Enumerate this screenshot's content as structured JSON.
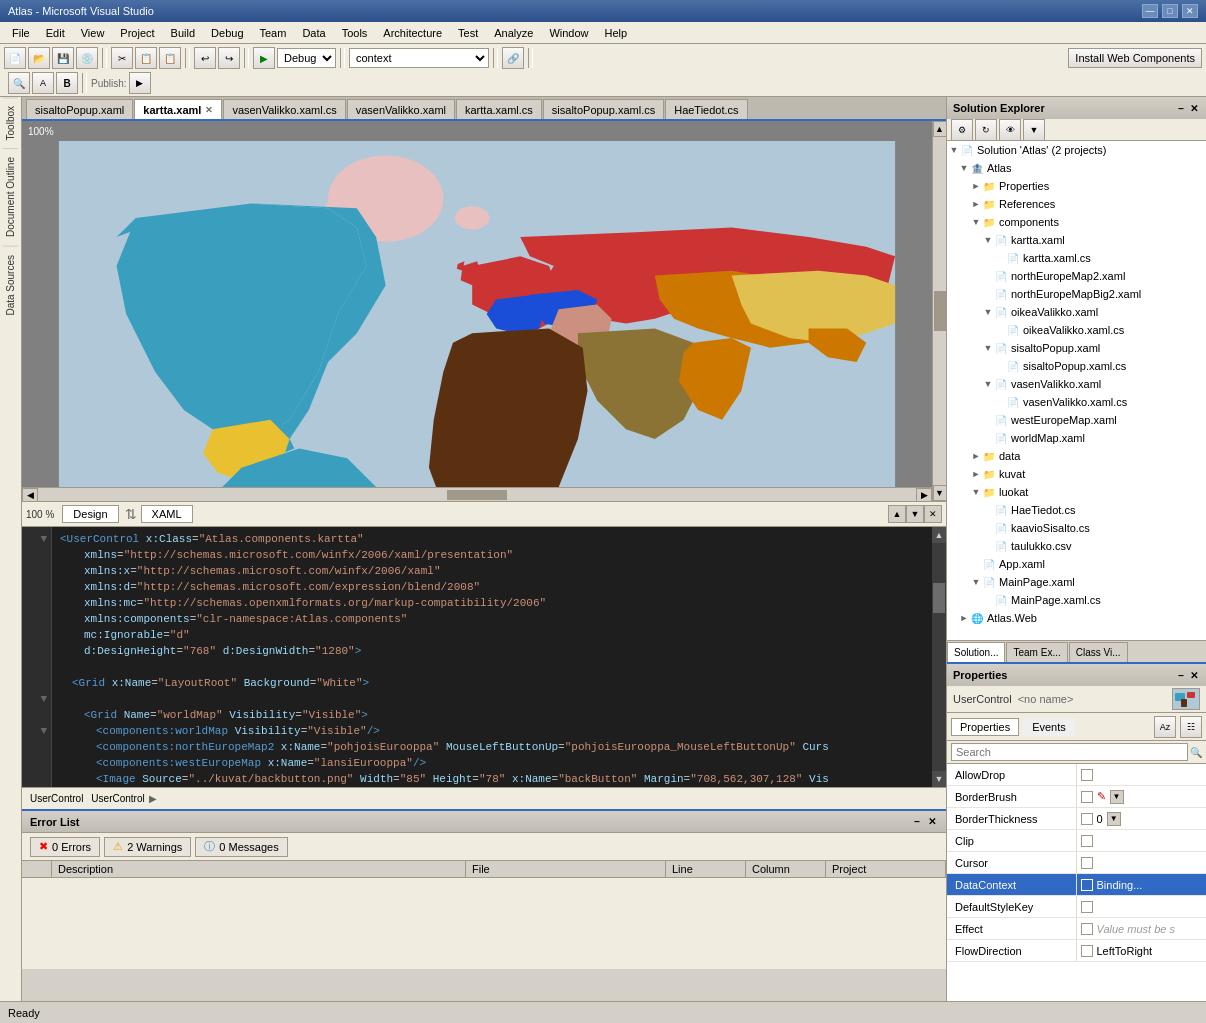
{
  "titleBar": {
    "title": "Atlas - Microsoft Visual Studio",
    "controls": [
      "minimize",
      "maximize",
      "close"
    ]
  },
  "menuBar": {
    "items": [
      "File",
      "Edit",
      "View",
      "Project",
      "Build",
      "Debug",
      "Team",
      "Data",
      "Tools",
      "Architecture",
      "Test",
      "Analyze",
      "Window",
      "Help"
    ]
  },
  "toolbar": {
    "debugMode": "Debug",
    "context": "context",
    "installWebComponents": "Install Web Components"
  },
  "documentTabs": {
    "tabs": [
      {
        "label": "sisaltoPopup.xaml",
        "active": false,
        "closeable": false
      },
      {
        "label": "kartta.xaml",
        "active": true,
        "closeable": true
      },
      {
        "label": "vasenValikko.xaml.cs",
        "active": false,
        "closeable": false
      },
      {
        "label": "vasenValikko.xaml",
        "active": false,
        "closeable": false
      },
      {
        "label": "kartta.xaml.cs",
        "active": false,
        "closeable": false
      },
      {
        "label": "sisaltoPopup.xaml.cs",
        "active": false,
        "closeable": false
      },
      {
        "label": "HaeTiedot.cs",
        "active": false,
        "closeable": false
      }
    ]
  },
  "viewTabs": {
    "design": "Design",
    "xaml": "XAML",
    "zoom": "100%"
  },
  "xamlCode": {
    "lines": [
      {
        "indent": 0,
        "content": "<UserControl x:Class=\"Atlas.components.kartta\""
      },
      {
        "indent": 1,
        "content": "xmlns=\"http://schemas.microsoft.com/winfx/2006/xaml/presentation\""
      },
      {
        "indent": 1,
        "content": "xmlns:x=\"http://schemas.microsoft.com/winfx/2006/xaml\""
      },
      {
        "indent": 1,
        "content": "xmlns:d=\"http://schemas.microsoft.com/expression/blend/2008\""
      },
      {
        "indent": 1,
        "content": "xmlns:mc=\"http://schemas.openxmlformats.org/markup-compatibility/2006\""
      },
      {
        "indent": 1,
        "content": "xmlns:components=\"clr-namespace:Atlas.components\""
      },
      {
        "indent": 1,
        "content": "mc:Ignorable=\"d\""
      },
      {
        "indent": 1,
        "content": "d:DesignHeight=\"768\" d:DesignWidth=\"1280\">"
      },
      {
        "indent": 0,
        "content": ""
      },
      {
        "indent": 1,
        "content": "<Grid x:Name=\"LayoutRoot\" Background=\"White\">"
      },
      {
        "indent": 0,
        "content": ""
      },
      {
        "indent": 2,
        "content": "<Grid Name=\"worldMap\" Visibility=\"Visible\">"
      },
      {
        "indent": 3,
        "content": "<components:worldMap Visibility=\"Visible\"/>"
      },
      {
        "indent": 3,
        "content": "<components:northEuropeMap2 x:Name=\"pohjoisEurooppa\" MouseLeftButtonUp=\"pohjoisEurooppa_MouseLeftButtonUp\" Curs"
      },
      {
        "indent": 3,
        "content": "<components:westEuropeMap x:Name=\"lansiEurooppa\"/>"
      },
      {
        "indent": 3,
        "content": "<Image Source=\"../kuvat/backbutton.png\" Width=\"85\" Height=\"78\" x:Name=\"backButton\" Margin=\"708,562,307,128\" Vis"
      }
    ]
  },
  "xamlStatus": {
    "element": "UserControl",
    "name": "UserControl"
  },
  "solutionExplorer": {
    "title": "Solution Explorer",
    "solutionLabel": "Solution 'Atlas' (2 projects)",
    "tree": [
      {
        "level": 0,
        "type": "solution",
        "label": "Solution 'Atlas' (2 projects)",
        "expanded": true
      },
      {
        "level": 1,
        "type": "project",
        "label": "Atlas",
        "expanded": true
      },
      {
        "level": 2,
        "type": "folder",
        "label": "Properties",
        "expanded": false
      },
      {
        "level": 2,
        "type": "folder",
        "label": "References",
        "expanded": false
      },
      {
        "level": 2,
        "type": "folder",
        "label": "components",
        "expanded": true
      },
      {
        "level": 3,
        "type": "folder",
        "label": "kartta.xaml",
        "expanded": true
      },
      {
        "level": 4,
        "type": "cs",
        "label": "kartta.xaml.cs"
      },
      {
        "level": 3,
        "type": "xaml",
        "label": "northEuropeMap2.xaml"
      },
      {
        "level": 3,
        "type": "xaml",
        "label": "northEuropeMapBig2.xaml"
      },
      {
        "level": 3,
        "type": "folder",
        "label": "oikeaValikko.xaml",
        "expanded": true
      },
      {
        "level": 4,
        "type": "cs",
        "label": "oikeaValikko.xaml.cs"
      },
      {
        "level": 3,
        "type": "folder",
        "label": "sisaltoPopup.xaml",
        "expanded": true
      },
      {
        "level": 4,
        "type": "cs",
        "label": "sisaltoPopup.xaml.cs"
      },
      {
        "level": 3,
        "type": "folder",
        "label": "vasenValikko.xaml",
        "expanded": true
      },
      {
        "level": 4,
        "type": "cs",
        "label": "vasenValikko.xaml.cs"
      },
      {
        "level": 3,
        "type": "xaml",
        "label": "westEuropeMap.xaml"
      },
      {
        "level": 3,
        "type": "xaml",
        "label": "worldMap.xaml"
      },
      {
        "level": 2,
        "type": "folder",
        "label": "data",
        "expanded": false
      },
      {
        "level": 2,
        "type": "folder",
        "label": "kuvat",
        "expanded": false
      },
      {
        "level": 2,
        "type": "folder",
        "label": "luokat",
        "expanded": true
      },
      {
        "level": 3,
        "type": "cs",
        "label": "HaeTiedot.cs"
      },
      {
        "level": 3,
        "type": "cs",
        "label": "kaavioSisalto.cs"
      },
      {
        "level": 3,
        "type": "csv",
        "label": "taulukko.csv"
      },
      {
        "level": 2,
        "type": "xaml",
        "label": "App.xaml"
      },
      {
        "level": 2,
        "type": "folder",
        "label": "MainPage.xaml",
        "expanded": true
      },
      {
        "level": 3,
        "type": "cs",
        "label": "MainPage.xaml.cs"
      },
      {
        "level": 1,
        "type": "project",
        "label": "Atlas.Web",
        "expanded": false
      }
    ]
  },
  "bottomTabs": {
    "tabs": [
      {
        "label": "Solution...",
        "active": true
      },
      {
        "label": "Team Ex...",
        "active": false
      },
      {
        "label": "Class Vi...",
        "active": false
      }
    ]
  },
  "properties": {
    "title": "Properties",
    "controlType": "UserControl",
    "controlName": "<no name>",
    "tabs": [
      "Properties",
      "Events"
    ],
    "searchPlaceholder": "Search",
    "rows": [
      {
        "name": "AllowDrop",
        "value": "",
        "checkbox": true,
        "checked": false
      },
      {
        "name": "BorderBrush",
        "value": "",
        "checkbox": true,
        "checked": false,
        "extra": "pencil"
      },
      {
        "name": "BorderThickness",
        "value": "0",
        "checkbox": true,
        "checked": false
      },
      {
        "name": "Clip",
        "value": "",
        "checkbox": true,
        "checked": false
      },
      {
        "name": "Cursor",
        "value": "",
        "checkbox": true,
        "checked": false
      },
      {
        "name": "DataContext",
        "value": "Binding...",
        "checkbox": true,
        "checked": true,
        "highlighted": true
      },
      {
        "name": "DefaultStyleKey",
        "value": "",
        "checkbox": true,
        "checked": false
      },
      {
        "name": "Effect",
        "value": "Value must be s",
        "checkbox": true,
        "checked": false
      },
      {
        "name": "FlowDirection",
        "value": "LeftToRight",
        "checkbox": true,
        "checked": false
      }
    ]
  },
  "errorList": {
    "title": "Error List",
    "errors": "0 Errors",
    "warnings": "2 Warnings",
    "messages": "0 Messages",
    "columns": [
      "",
      "Description",
      "File",
      "Line",
      "Column",
      "Project"
    ],
    "rows": []
  },
  "statusBar": {
    "text": "Ready"
  },
  "sidebar": {
    "items": [
      "Toolbox",
      "Document Outline",
      "Data Sources"
    ]
  }
}
